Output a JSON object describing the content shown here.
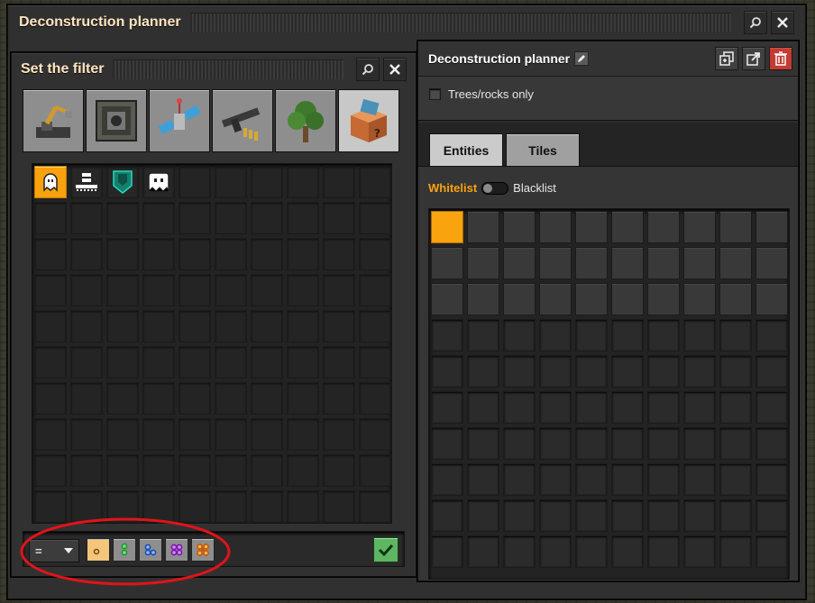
{
  "back_window": {
    "title": "Deconstruction planner",
    "search_icon": "search-icon",
    "close_icon": "close-icon"
  },
  "filter_window": {
    "title": "Set the filter",
    "search_icon": "search-icon",
    "close_icon": "close-icon",
    "item_groups": [
      {
        "name": "logistics",
        "icon": "inserter-icon",
        "selected": false
      },
      {
        "name": "production",
        "icon": "assembler-icon",
        "selected": false
      },
      {
        "name": "intermediate-products",
        "icon": "satellite-icon",
        "selected": false
      },
      {
        "name": "combat",
        "icon": "gun-icon",
        "selected": false
      },
      {
        "name": "environment",
        "icon": "tree-icon",
        "selected": false
      },
      {
        "name": "other",
        "icon": "unknown-box-icon",
        "selected": true
      }
    ],
    "items": [
      {
        "name": "entity-ghost",
        "icon": "ghost-icon",
        "selected": true
      },
      {
        "name": "item-on-ground",
        "icon": "item-on-ground-icon",
        "selected": false
      },
      {
        "name": "shield",
        "icon": "shield-icon",
        "selected": false
      },
      {
        "name": "tile-ghost",
        "icon": "tile-ghost-icon",
        "selected": false
      }
    ],
    "comparator": "=",
    "comparator_icon": "chevron-down-icon",
    "quality_buttons": [
      {
        "name": "normal",
        "color": "#e0a040",
        "selected": true
      },
      {
        "name": "uncommon",
        "color": "#36c24a",
        "selected": false
      },
      {
        "name": "rare",
        "color": "#2f6fe0",
        "selected": false
      },
      {
        "name": "epic",
        "color": "#b22fe0",
        "selected": false
      },
      {
        "name": "legendary",
        "color": "#f07a10",
        "selected": false
      }
    ],
    "confirm_icon": "check-icon"
  },
  "planner": {
    "title": "Deconstruction planner",
    "edit_icon": "pencil-icon",
    "copy_icon": "copy-icon",
    "export_icon": "export-icon",
    "delete_icon": "trash-icon",
    "trees_rocks_label": "Trees/rocks only",
    "trees_rocks_checked": false,
    "tabs": [
      {
        "label": "Entities",
        "selected": true
      },
      {
        "label": "Tiles",
        "selected": false
      }
    ],
    "whitelist_label": "Whitelist",
    "blacklist_label": "Blacklist",
    "mode": "whitelist",
    "filter_slots_selected": 1
  },
  "colors": {
    "accent_orange": "#f7a20e",
    "title": "#ffe6c0",
    "delete_red": "#c43b33",
    "confirm_green": "#5eb663"
  }
}
